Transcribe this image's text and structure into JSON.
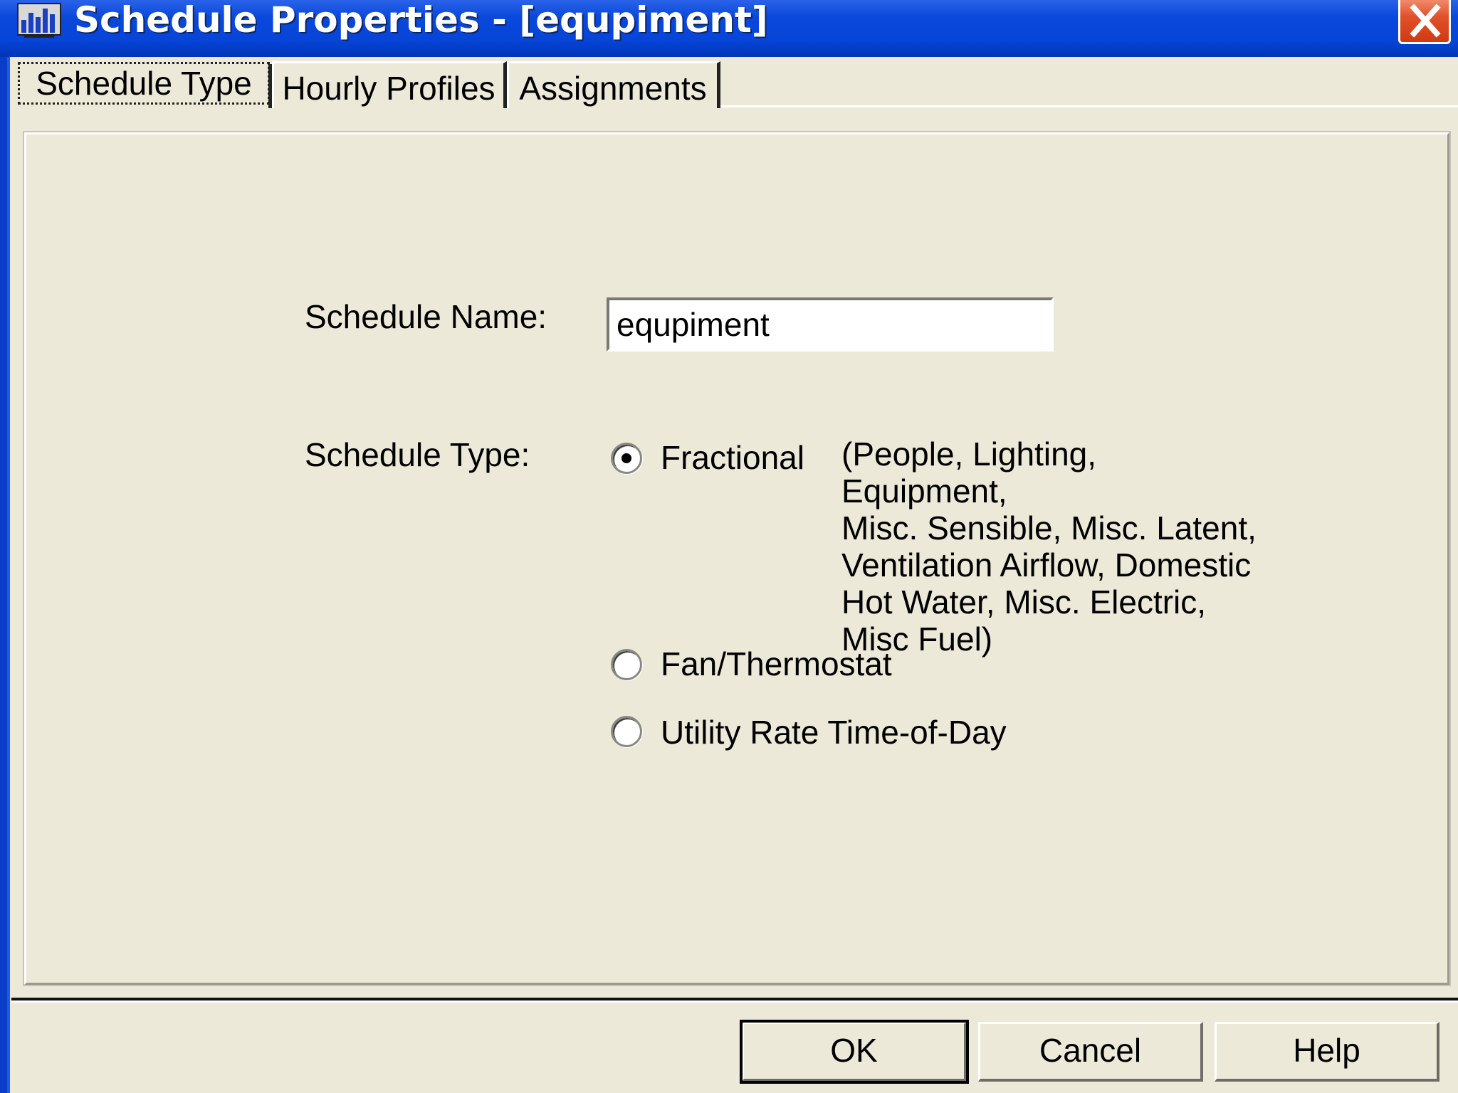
{
  "window": {
    "title": "Schedule Properties - [equpiment]",
    "title_icon": "bar-chart-app-icon",
    "close_icon": "close-x-icon"
  },
  "tabs": [
    {
      "label": "Schedule Type",
      "active": true
    },
    {
      "label": "Hourly Profiles",
      "active": false
    },
    {
      "label": "Assignments",
      "active": false
    }
  ],
  "form": {
    "name_label": "Schedule Name:",
    "name_value": "equpiment",
    "type_label": "Schedule Type:",
    "options": [
      {
        "label": "Fractional",
        "selected": true
      },
      {
        "label": "Fan/Thermostat",
        "selected": false
      },
      {
        "label": "Utility Rate Time-of-Day",
        "selected": false
      }
    ],
    "fractional_note": "(People, Lighting, Equipment,\nMisc. Sensible, Misc. Latent,\nVentilation Airflow, Domestic\nHot Water, Misc. Electric,\nMisc Fuel)"
  },
  "buttons": {
    "ok": "OK",
    "cancel": "Cancel",
    "help": "Help"
  },
  "colors": {
    "titlebar": "#0A48DC",
    "dialog_bg": "#ECE9D8",
    "close_button": "#D03A12"
  }
}
